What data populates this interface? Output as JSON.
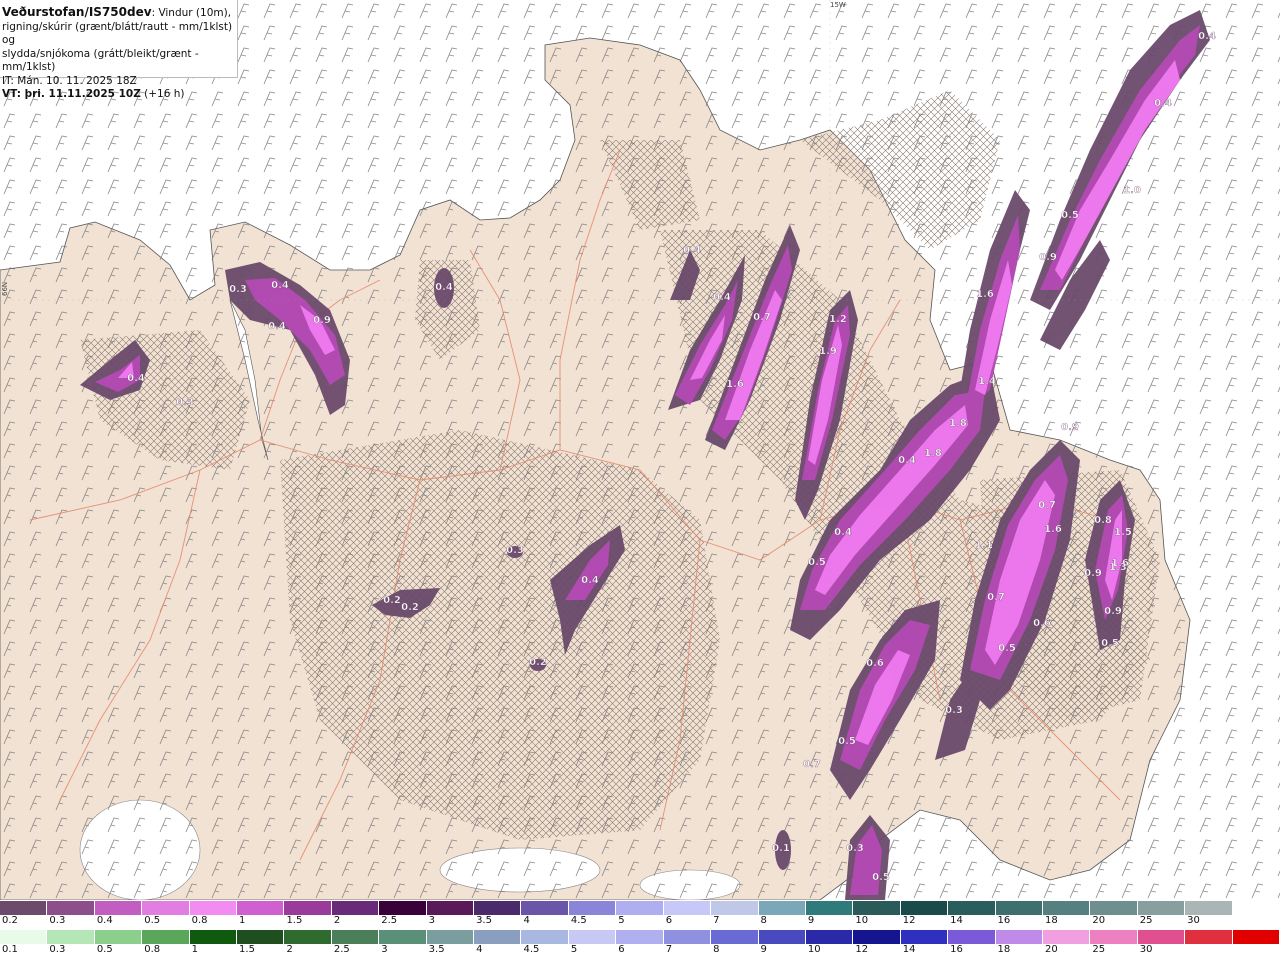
{
  "header": {
    "source": "Veðurstofan/IS750dev",
    "desc_part1": ": Vindur (10m),",
    "desc_line2": "rigning/skúrir (grænt/blátt/rautt - mm/1klst) og",
    "desc_line3": "slydda/snjókoma (grátt/bleikt/grænt - mm/1klst)",
    "init_time": "IT: Mán. 10. 11. 2025 18Z",
    "valid_prefix": "VT: þri. 11.11.2025 10Z",
    "valid_suffix": " (+16 h)"
  },
  "edge_labels": {
    "lon": "15W",
    "lat": "66N"
  },
  "map_labels": [
    "0.4",
    "0.4",
    "0.4",
    "0.3",
    "0.4",
    "0.4",
    "0.9",
    "0.4",
    "0.4",
    "0.3",
    "0.2",
    "0.2",
    "0.3",
    "0.4",
    "0.2",
    "0.4",
    "0.7",
    "1.6",
    "1.2",
    "1.9",
    "1.6",
    "0.5",
    "0.9",
    "0.9",
    "0.4",
    "1.8",
    "1.8",
    "1.4",
    "1.0",
    "0.4",
    "0.5",
    "1.1",
    "0.7",
    "0.8",
    "1.5",
    "1.6",
    "1.6",
    "0.9",
    "1.3",
    "0.7",
    "0.6",
    "0.9",
    "0.5",
    "0.5",
    "0.6",
    "0.5",
    "0.3",
    "0.7",
    "0.3",
    "0.1",
    "0.5"
  ],
  "legend_snow": {
    "colors": [
      "#6b4a6b",
      "#8c4f8c",
      "#c25ec2",
      "#e27de2",
      "#f28cf2",
      "#d05fd0",
      "#9a3a9a",
      "#6a2a7a",
      "#3a003a",
      "#5a1a5a",
      "#4b2a6b",
      "#6b55a8",
      "#8a85d8",
      "#aeaef0",
      "#c8c8f8",
      "#c0c8e8",
      "#7aa8b8",
      "#2f7a7a",
      "#2a5a5a",
      "#1a4a4a",
      "#2a5e5e",
      "#3d6f6f",
      "#567f7f",
      "#6f8f8f",
      "#889fa0",
      "#aab5b5",
      "#ffffff"
    ],
    "ticks": [
      "0.2",
      "0.3",
      "0.4",
      "0.5",
      "0.8",
      "1",
      "1.5",
      "2",
      "2.5",
      "3",
      "3.5",
      "4",
      "4.5",
      "5",
      "6",
      "7",
      "8",
      "9",
      "10",
      "12",
      "14",
      "16",
      "18",
      "20",
      "25",
      "30"
    ]
  },
  "legend_rain": {
    "colors": [
      "#e8fbe8",
      "#b5e6b5",
      "#8ccf8c",
      "#5aa65a",
      "#0f5a0f",
      "#1f4f1f",
      "#2f6a2f",
      "#4a7f5a",
      "#5a8f78",
      "#7a9ea0",
      "#8a9fbf",
      "#a8b8e0",
      "#c8c8f5",
      "#b0b0f0",
      "#9090e0",
      "#6a6ad5",
      "#4a4ac0",
      "#2a2aa8",
      "#15158f",
      "#3030c0",
      "#7a5ad8",
      "#c08ae8",
      "#f0a0e0",
      "#ec80c0",
      "#e05090",
      "#e03040",
      "#e00000"
    ],
    "ticks": [
      "0.1",
      "0.3",
      "0.5",
      "0.8",
      "1",
      "1.5",
      "2",
      "2.5",
      "3",
      "3.5",
      "4",
      "4.5",
      "5",
      "6",
      "7",
      "8",
      "9",
      "10",
      "12",
      "14",
      "16",
      "18",
      "20",
      "25",
      "30"
    ]
  },
  "colors": {
    "land": "#f1e2d4",
    "sea": "#ffffff",
    "snow_light": "#6b4a6b",
    "snow_mid": "#b44ab4",
    "snow_heavy": "#f07af0",
    "roads": "#e8876a"
  }
}
